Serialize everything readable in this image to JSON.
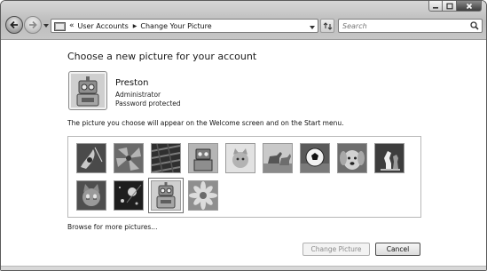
{
  "window": {
    "breadcrumb": [
      "User Accounts",
      "Change Your Picture"
    ],
    "breadcrumb_prefix": "«",
    "search_placeholder": "Search"
  },
  "content": {
    "heading": "Choose a new picture for your account",
    "user": {
      "name": "Preston",
      "role": "Administrator",
      "status": "Password protected"
    },
    "info": "The picture you choose will appear on the Welcome screen and on the Start menu.",
    "pictures": [
      {
        "icon": "guitar-picture",
        "selected": false
      },
      {
        "icon": "leaves-picture",
        "selected": false
      },
      {
        "icon": "texture-picture",
        "selected": false
      },
      {
        "icon": "robot-picture",
        "selected": false
      },
      {
        "icon": "kitten-picture",
        "selected": false
      },
      {
        "icon": "horses-picture",
        "selected": false
      },
      {
        "icon": "soccer-ball-picture",
        "selected": false
      },
      {
        "icon": "puppy-picture",
        "selected": false
      },
      {
        "icon": "chess-picture",
        "selected": false
      },
      {
        "icon": "cat-picture",
        "selected": false
      },
      {
        "icon": "sparkles-picture",
        "selected": false
      },
      {
        "icon": "robot-toy-picture",
        "selected": true
      },
      {
        "icon": "flower-picture",
        "selected": false
      }
    ],
    "browse_link": "Browse for more pictures..."
  },
  "footer": {
    "change_picture_label": "Change Picture",
    "cancel_label": "Cancel"
  }
}
